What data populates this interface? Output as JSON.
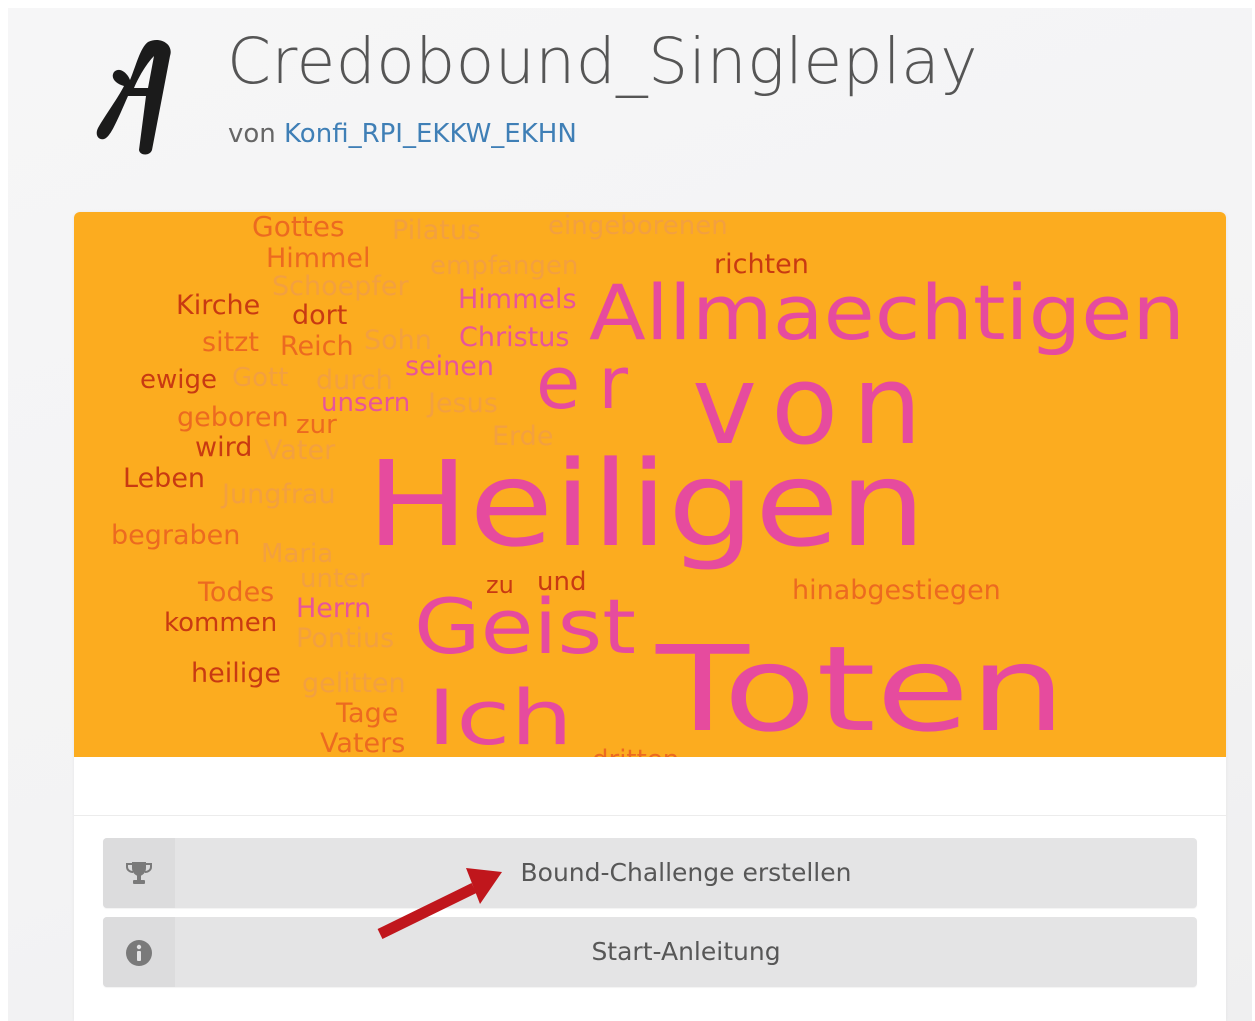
{
  "header": {
    "title": "Credobound_Singleplay",
    "by_prefix": "von",
    "author": "Konfi_RPI_EKKW_EKHN",
    "logo_icon": "script-a-logo-icon"
  },
  "wordcloud": {
    "background": "#fcac1f",
    "words": [
      {
        "text": "Gottes",
        "color": "#ec6a20"
      },
      {
        "text": "Pilatus",
        "color": "#f2a040"
      },
      {
        "text": "eingeborenen",
        "color": "#f2a040"
      },
      {
        "text": "Himmel",
        "color": "#ec6a20"
      },
      {
        "text": "empfangen",
        "color": "#f2a040"
      },
      {
        "text": "richten",
        "color": "#c83a12"
      },
      {
        "text": "Schoepfer",
        "color": "#f2a040"
      },
      {
        "text": "Kirche",
        "color": "#c83a12"
      },
      {
        "text": "dort",
        "color": "#c83a12"
      },
      {
        "text": "Himmels",
        "color": "#e8559a"
      },
      {
        "text": "Allmaechtigen",
        "color": "#e64b9e"
      },
      {
        "text": "sitzt",
        "color": "#ec6a20"
      },
      {
        "text": "Reich",
        "color": "#ec6a20"
      },
      {
        "text": "Sohn",
        "color": "#f2a040"
      },
      {
        "text": "Christus",
        "color": "#e8559a"
      },
      {
        "text": "ewige",
        "color": "#c83a12"
      },
      {
        "text": "Gott",
        "color": "#f2a040"
      },
      {
        "text": "durch",
        "color": "#f2a040"
      },
      {
        "text": "seinen",
        "color": "#e8559a"
      },
      {
        "text": "er",
        "color": "#e64b9e"
      },
      {
        "text": "von",
        "color": "#e64b9e"
      },
      {
        "text": "unsern",
        "color": "#e8559a"
      },
      {
        "text": "Jesus",
        "color": "#f2a040"
      },
      {
        "text": "geboren",
        "color": "#ec6a20"
      },
      {
        "text": "zur",
        "color": "#ec6a20"
      },
      {
        "text": "Erde",
        "color": "#f2a040"
      },
      {
        "text": "wird",
        "color": "#c83a12"
      },
      {
        "text": "Vater",
        "color": "#f2a040"
      },
      {
        "text": "Heiligen",
        "color": "#e64b9e"
      },
      {
        "text": "Leben",
        "color": "#c83a12"
      },
      {
        "text": "Jungfrau",
        "color": "#f2a040"
      },
      {
        "text": "begraben",
        "color": "#ec6a20"
      },
      {
        "text": "Maria",
        "color": "#f2a040"
      },
      {
        "text": "unter",
        "color": "#f2a040"
      },
      {
        "text": "zu",
        "color": "#c83a12"
      },
      {
        "text": "und",
        "color": "#c83a12"
      },
      {
        "text": "hinabgestiegen",
        "color": "#ec6a20"
      },
      {
        "text": "Todes",
        "color": "#ec6a20"
      },
      {
        "text": "Herrn",
        "color": "#e8559a"
      },
      {
        "text": "Geist",
        "color": "#e64b9e"
      },
      {
        "text": "kommen",
        "color": "#c83a12"
      },
      {
        "text": "Pontius",
        "color": "#f2a040"
      },
      {
        "text": "Toten",
        "color": "#e64b9e"
      },
      {
        "text": "heilige",
        "color": "#c83a12"
      },
      {
        "text": "gelitten",
        "color": "#f2a040"
      },
      {
        "text": "Ich",
        "color": "#e64b9e"
      },
      {
        "text": "Tage",
        "color": "#ec6a20"
      },
      {
        "text": "Vaters",
        "color": "#ec6a20"
      },
      {
        "text": "dritten",
        "color": "#ec6a20"
      }
    ]
  },
  "actions": [
    {
      "label": "Bound-Challenge erstellen",
      "icon": "trophy-icon"
    },
    {
      "label": "Start-Anleitung",
      "icon": "info-circle-icon"
    }
  ],
  "annotation": {
    "icon": "red-arrow-icon",
    "color": "#c0161c"
  }
}
